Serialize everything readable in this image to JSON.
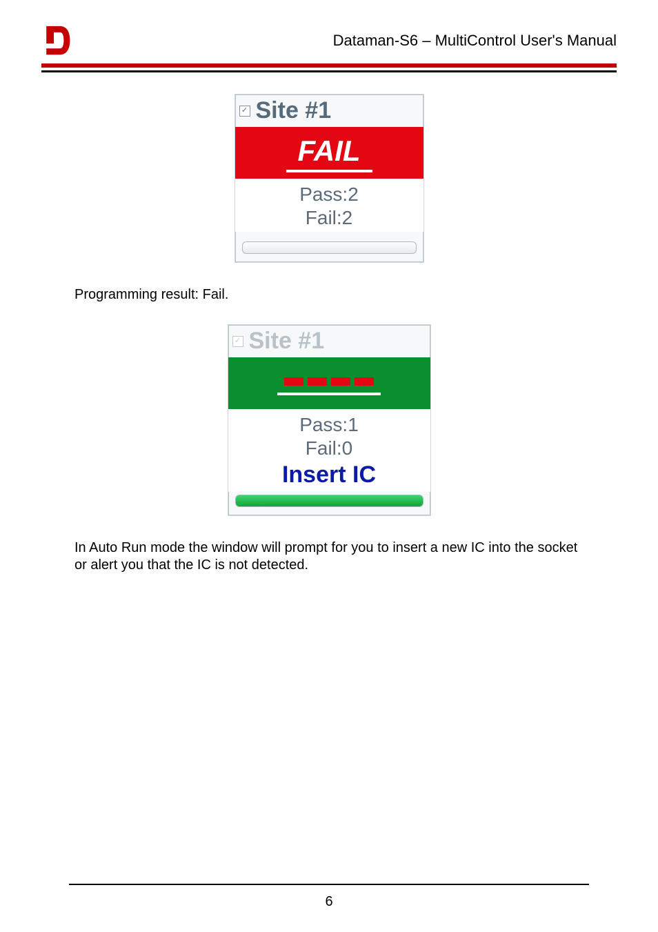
{
  "header": {
    "title": "Dataman-S6 – MultiControl User's Manual"
  },
  "panel1": {
    "site_label": "Site #1",
    "status_text": "FAIL",
    "pass_line": "Pass:2",
    "fail_line": "Fail:2"
  },
  "caption1": "Programming result: Fail.",
  "panel2": {
    "site_label": "Site #1",
    "pass_line": "Pass:1",
    "fail_line": "Fail:0",
    "prompt": "Insert IC"
  },
  "body2": "In Auto Run mode the window will prompt for you to insert a new IC into the socket or alert you that the IC is not detected.",
  "page_number": "6"
}
